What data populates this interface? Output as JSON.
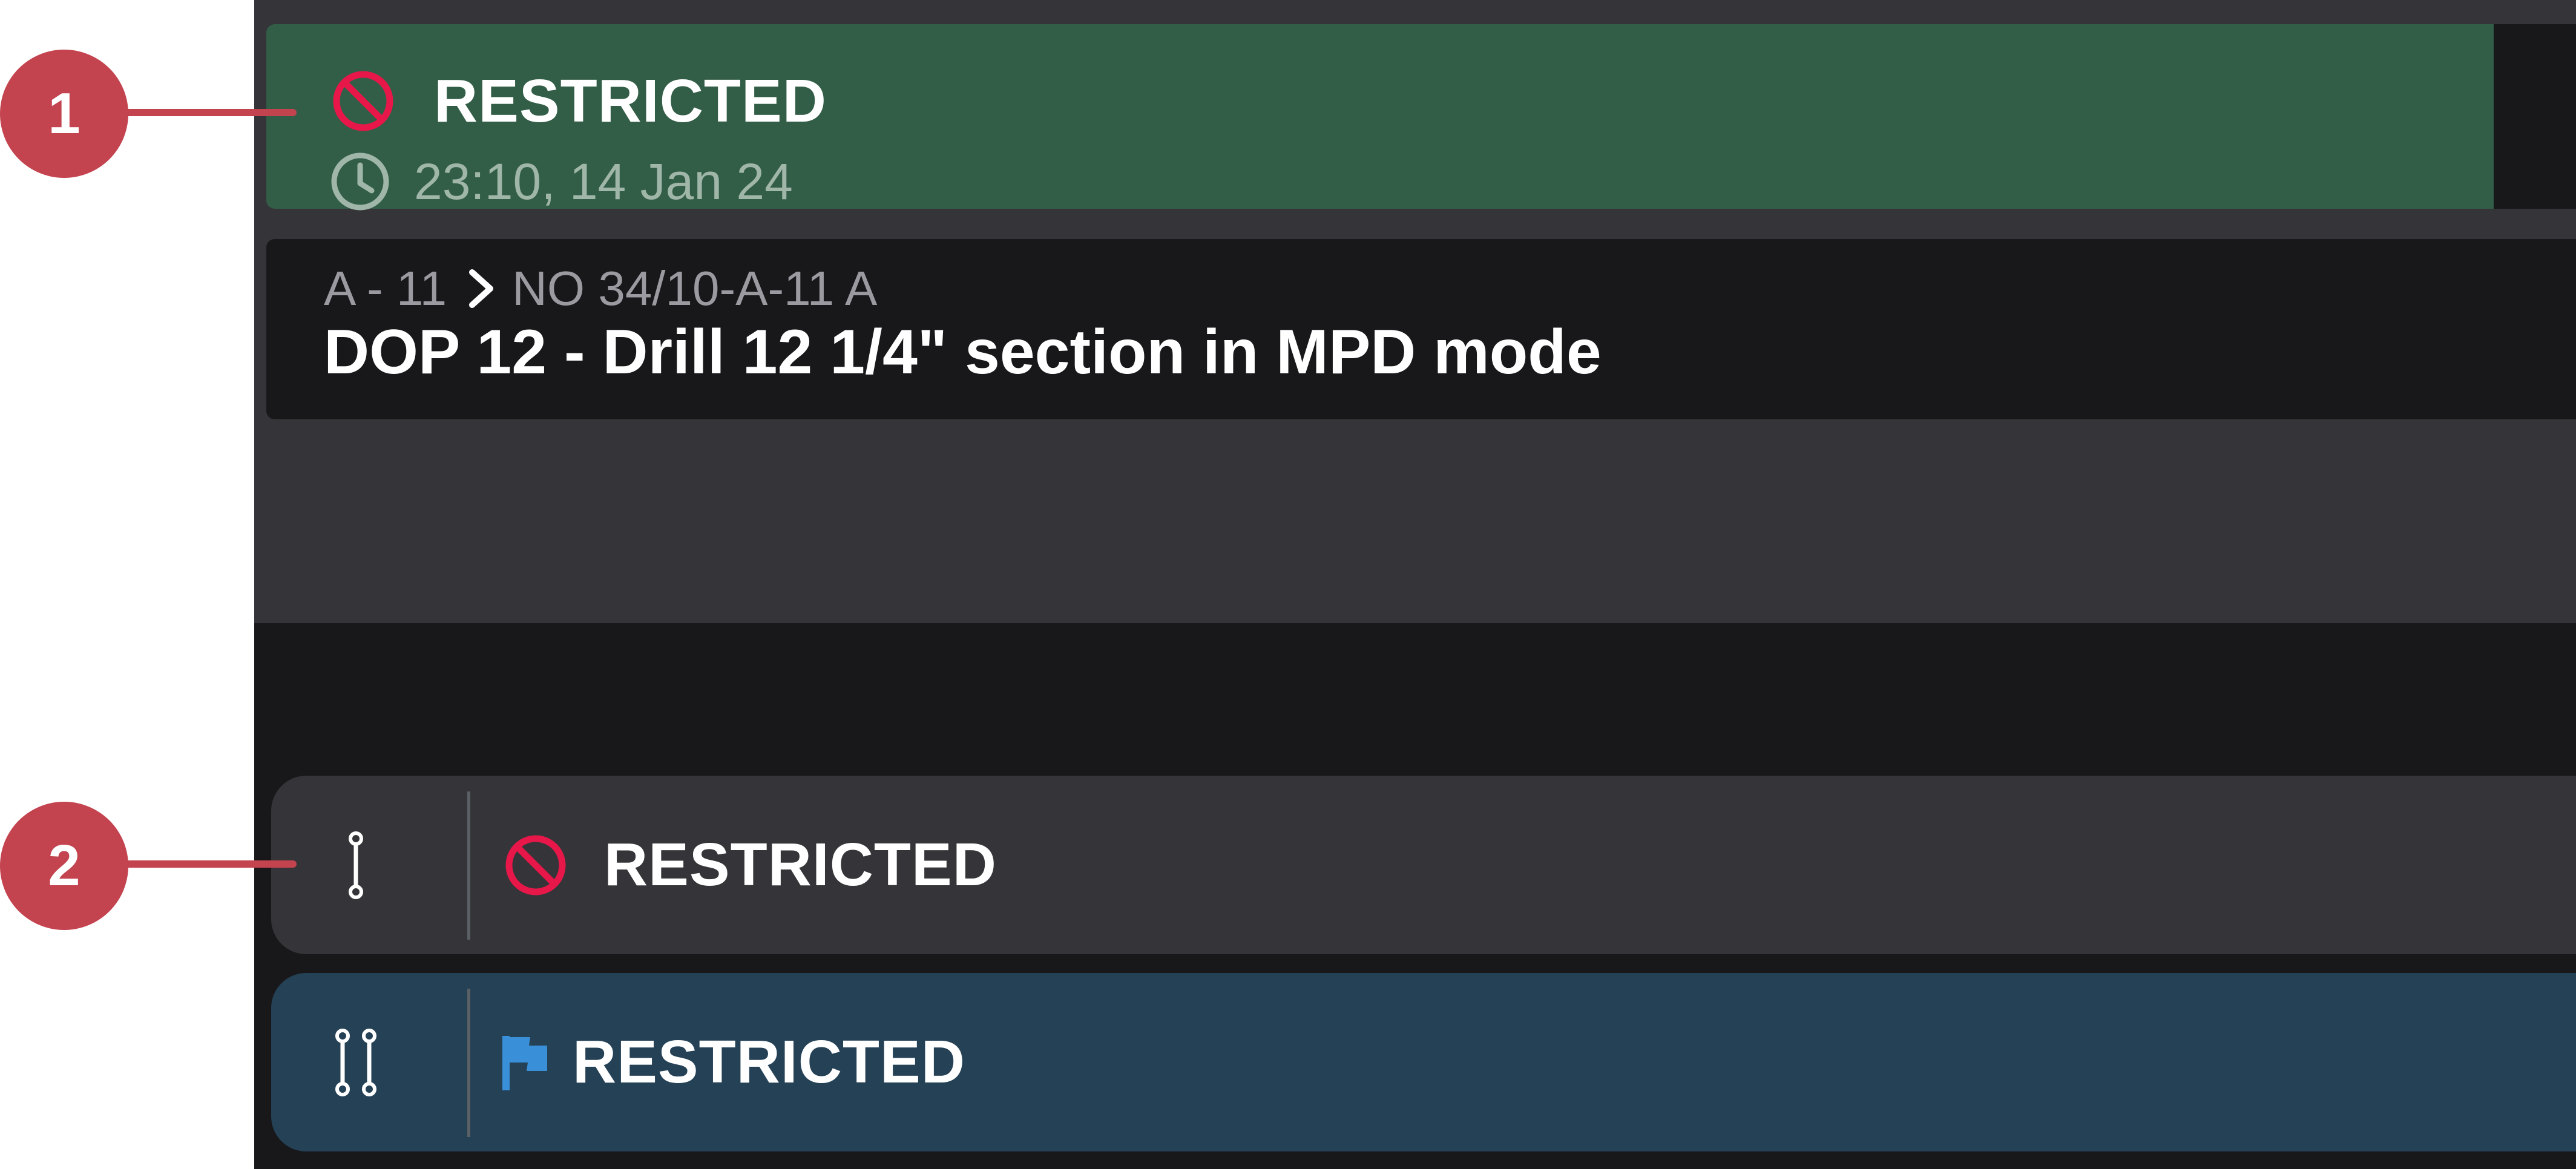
{
  "status_card": {
    "label": "RESTRICTED",
    "timestamp": "23:10, 14 Jan 24",
    "status_icon": "restricted-icon",
    "time_icon": "clock-icon",
    "background_color": "#325e47"
  },
  "task_card": {
    "breadcrumb": {
      "parent": "A - 11",
      "separator_icon": "chevron-right-icon",
      "child": "NO 34/10-A-11 A"
    },
    "title": "DOP 12 - Drill 12 1/4\" section in MPD mode"
  },
  "rows": [
    {
      "icon": "single-connector-icon",
      "status_icon": "restricted-icon",
      "label": "RESTRICTED",
      "background_color": "#353438"
    },
    {
      "icon": "double-connector-icon",
      "status_icon": "flag-icon",
      "label": "RESTRICTED",
      "background_color": "#254156"
    }
  ],
  "callouts": [
    {
      "number": "1",
      "color": "#c3434f"
    },
    {
      "number": "2",
      "color": "#c3434f"
    }
  ],
  "colors": {
    "restricted_red": "#e8174a",
    "flag_blue": "#3a8fd9",
    "app_background": "#18181b"
  }
}
